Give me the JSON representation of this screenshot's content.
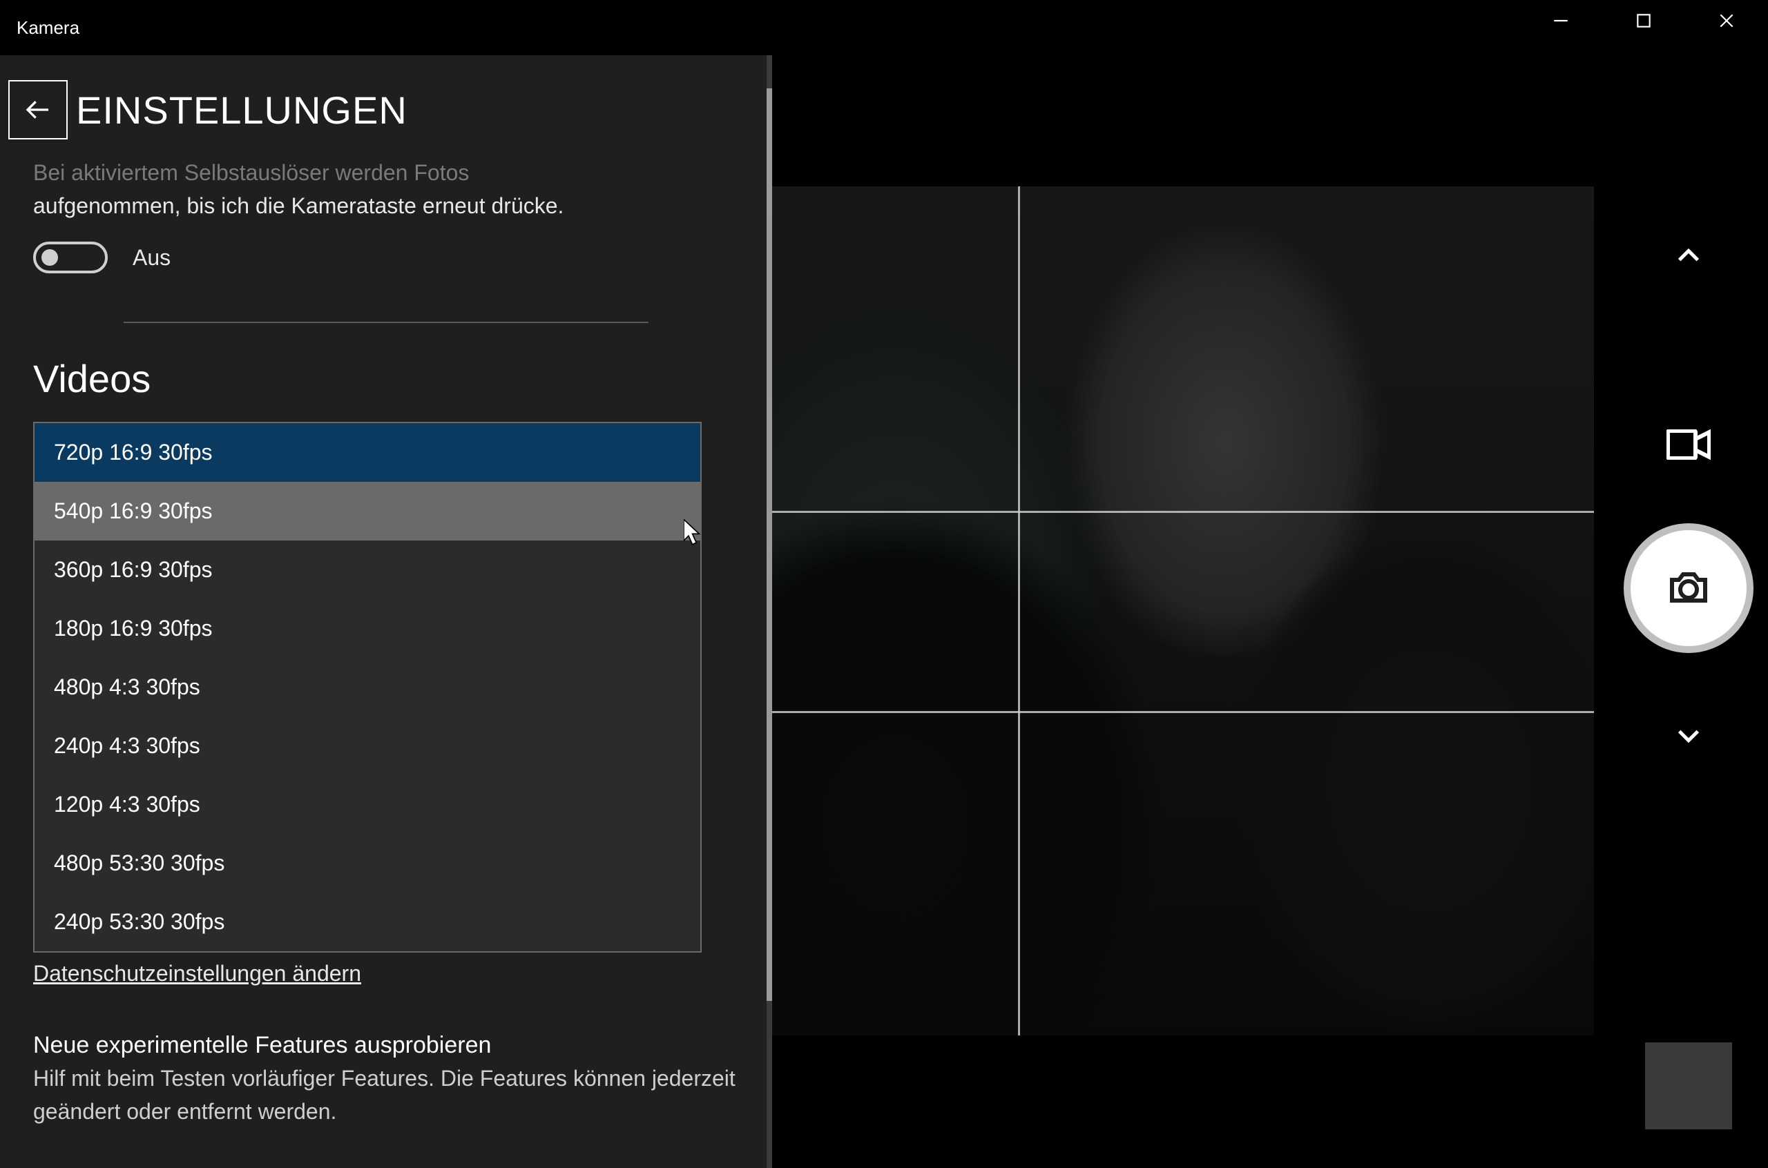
{
  "app_title": "Kamera",
  "settings": {
    "title": "EINSTELLUNGEN",
    "selftimer_text_faded": "Bei aktiviertem Selbstauslöser werden Fotos",
    "selftimer_text": "aufgenommen, bis ich die Kamerataste erneut drücke.",
    "toggle_label": "Aus",
    "toggle_on": false,
    "section_videos": "Videos",
    "video_options": [
      "720p 16:9 30fps",
      "540p 16:9 30fps",
      "360p 16:9 30fps",
      "180p 16:9 30fps",
      "480p 4:3 30fps",
      "240p 4:3 30fps",
      "120p 4:3 30fps",
      "480p 53:30 30fps",
      "240p 53:30 30fps"
    ],
    "video_selected_index": 0,
    "video_hovered_index": 1,
    "privacy_link": "Datenschutzeinstellungen ändern",
    "experimental_title": "Neue experimentelle Features ausprobieren",
    "experimental_body": "Hilf mit beim Testen vorläufiger Features. Die Features können jederzeit geändert oder entfernt werden."
  }
}
